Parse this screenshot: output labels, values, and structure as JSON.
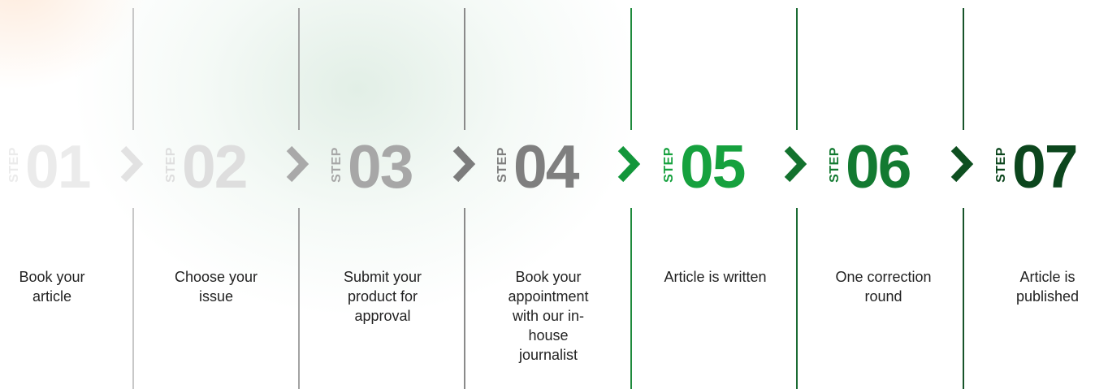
{
  "process": {
    "step_word": "STEP",
    "steps": [
      {
        "number": "01",
        "caption": "Book your article",
        "color": "#ebebeb",
        "chevron_color": "#e2e2e2",
        "divider_color": "#dcdcdc"
      },
      {
        "number": "02",
        "caption": "Choose your issue",
        "color": "#dedede",
        "chevron_color": "#a9a9a9",
        "divider_color": "#c8c8c8"
      },
      {
        "number": "03",
        "caption": "Submit your product for approval",
        "color": "#a7a7a7",
        "chevron_color": "#7c7c7c",
        "divider_color": "#a3a3a3"
      },
      {
        "number": "04",
        "caption": "Book your appointment with our in-house journalist",
        "color": "#7f7f7f",
        "chevron_color": "#12963a",
        "divider_color": "#8a8a8a"
      },
      {
        "number": "05",
        "caption": "Article is written",
        "color": "#16a13e",
        "chevron_color": "#13722e",
        "divider_color": "#1e8a3c"
      },
      {
        "number": "06",
        "caption": "One correction round",
        "color": "#137a31",
        "chevron_color": "#0e4f20",
        "divider_color": "#1b6b33"
      },
      {
        "number": "07",
        "caption": "Article is published",
        "color": "#0c461d",
        "chevron_color": null,
        "divider_color": "#17542a"
      }
    ]
  }
}
